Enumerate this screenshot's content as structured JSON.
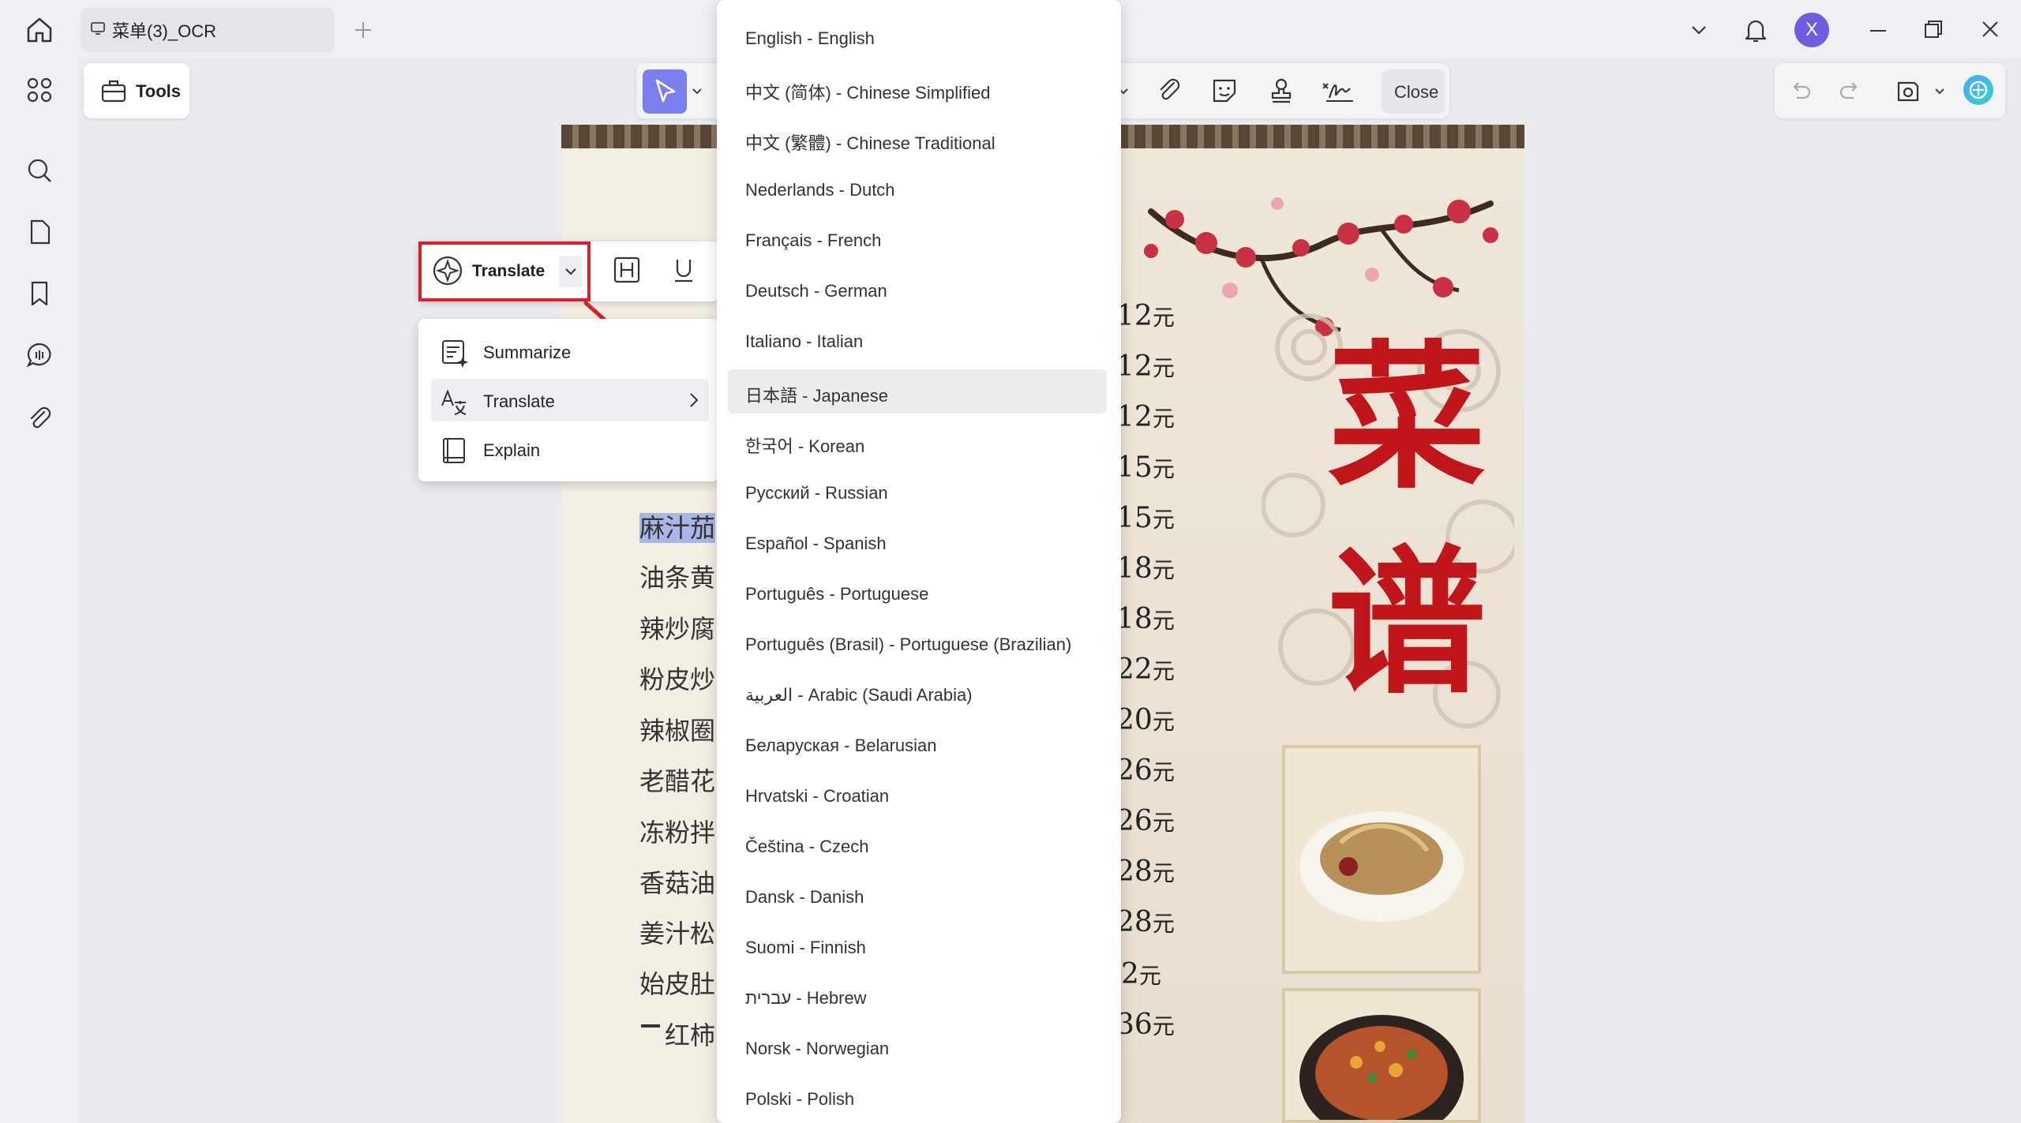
{
  "window": {
    "tab_title": "菜单(3)_OCR",
    "avatar_letter": "X",
    "accent_color": "#7b7fee",
    "highlight_color": "#e01d2b"
  },
  "toolbar": {
    "tools_label": "Tools",
    "close_label": "Close"
  },
  "floating_toolbar": {
    "translate_label": "Translate"
  },
  "ai_menu": {
    "items": [
      {
        "label": "Summarize",
        "icon": "summarize-icon"
      },
      {
        "label": "Translate",
        "icon": "translate-icon"
      },
      {
        "label": "Explain",
        "icon": "book-icon"
      }
    ]
  },
  "languages": {
    "selected": "日本語 - Japanese",
    "items": [
      "English - English",
      "中文 (简体) - Chinese Simplified",
      "中文 (繁體) - Chinese Traditional",
      "Nederlands - Dutch",
      "Français - French",
      "Deutsch - German",
      "Italiano - Italian",
      "日本語 - Japanese",
      "한국어 - Korean",
      "Русский - Russian",
      "Español - Spanish",
      "Português - Portuguese",
      "Português (Brasil) - Portuguese (Brazilian)",
      "العربية - Arabic (Saudi Arabia)",
      "Беларуская - Belarusian",
      "Hrvatski - Croatian",
      "Čeština - Czech",
      "Dansk - Danish",
      "Suomi - Finnish",
      "עברית - Hebrew",
      "Norsk - Norwegian",
      "Polski - Polish"
    ]
  },
  "document": {
    "title_chars": [
      "菜",
      "谱"
    ],
    "dish_fragments": [
      "麻汁茄",
      "油条黄",
      "辣炒腐",
      "粉皮炒",
      "辣椒圈",
      "老醋花",
      "冻粉拌",
      "香菇油",
      "姜汁松",
      "始皮肚",
      "红柿"
    ],
    "currency": "元",
    "prices": [
      "12",
      "12",
      "12",
      "15",
      "15",
      "18",
      "18",
      "22",
      "20",
      "26",
      "26",
      "28",
      "28",
      "2",
      "36"
    ]
  }
}
